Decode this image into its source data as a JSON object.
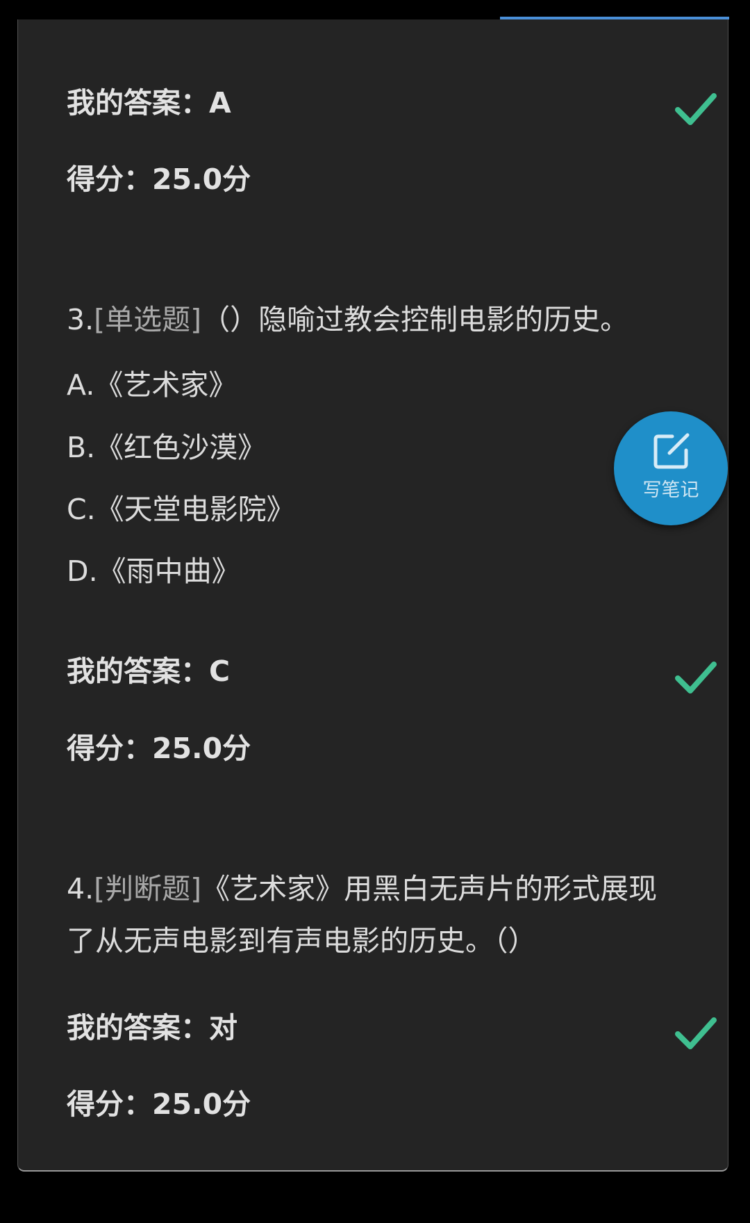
{
  "colors": {
    "check": "#3fbf90",
    "fab": "#1f8fc9",
    "card_bg": "#242424",
    "accent_line": "#4a8fd8"
  },
  "q2": {
    "my_answer_label": "我的答案：",
    "my_answer_value": "A",
    "score": "得分：25.0分",
    "result_icon": "checkmark-icon"
  },
  "q3": {
    "number": "3.",
    "type": "[单选题]",
    "stem": "（）隐喻过教会控制电影的历史。",
    "options": [
      {
        "letter": "A.",
        "text": "《艺术家》"
      },
      {
        "letter": "B.",
        "text": "《红色沙漠》"
      },
      {
        "letter": "C.",
        "text": "《天堂电影院》"
      },
      {
        "letter": "D.",
        "text": "《雨中曲》"
      }
    ],
    "my_answer_label": "我的答案：",
    "my_answer_value": "C",
    "score": "得分：25.0分",
    "result_icon": "checkmark-icon"
  },
  "q4": {
    "number": "4.",
    "type": "[判断题]",
    "stem_line1": "《艺术家》用黑白无声片的形式展现",
    "stem_line2": "了从无声电影到有声电影的历史。（）",
    "my_answer_label": "我的答案：",
    "my_answer_value": "对",
    "score": "得分：25.0分",
    "result_icon": "checkmark-icon"
  },
  "fab": {
    "label": "写笔记",
    "icon": "edit-note-icon"
  }
}
